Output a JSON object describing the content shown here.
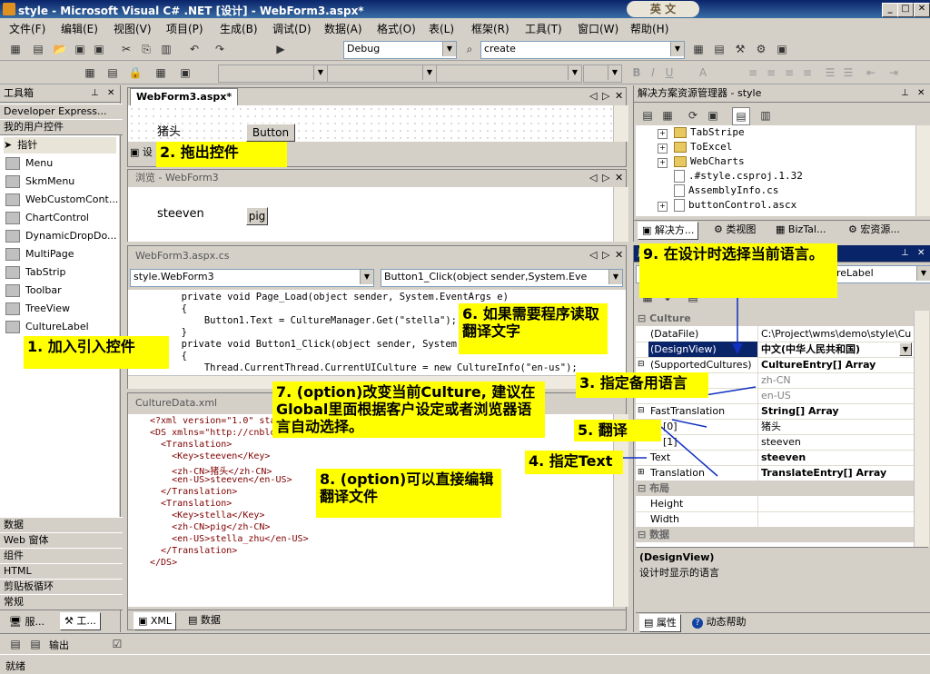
{
  "window": {
    "title": "style - Microsoft Visual C# .NET [设计] - WebForm3.aspx*",
    "logo_text": "英 文",
    "min": "_",
    "max": "□",
    "close": "✕"
  },
  "menu": [
    "文件(F)",
    "编辑(E)",
    "视图(V)",
    "项目(P)",
    "生成(B)",
    "调试(D)",
    "数据(A)",
    "格式(O)",
    "表(L)",
    "框架(R)",
    "工具(T)",
    "窗口(W)",
    "帮助(H)"
  ],
  "toolbar": {
    "config": "Debug",
    "find": "create"
  },
  "toolbox": {
    "title": "工具箱",
    "categories_top": [
      "Developer Express...",
      "我的用户控件"
    ],
    "items": [
      "指针",
      "Menu",
      "SkmMenu",
      "WebCustomCont...",
      "ChartControl",
      "DynamicDropDo...",
      "MultiPage",
      "TabStrip",
      "Toolbar",
      "TreeView",
      "CultureLabel"
    ],
    "categories_bottom": [
      "数据",
      "Web 窗体",
      "组件",
      "HTML",
      "剪贴板循环",
      "常规"
    ],
    "bottom_tabs": [
      "服...",
      "工..."
    ]
  },
  "designer": {
    "tab": "WebForm3.aspx*",
    "label_text": "猪头",
    "button_text": "Button"
  },
  "browser": {
    "title": "浏览 - WebForm3",
    "text": "steeven",
    "button_text": "pig"
  },
  "code": {
    "tab": "WebForm3.aspx.cs",
    "class_combo": "style.WebForm3",
    "method_combo": "Button1_Click(object sender,System.Eve",
    "lines": [
      "        private void Page_Load(object sender, System.EventArgs e)",
      "        {",
      "            Button1.Text = CultureManager.Get(\"stella\");",
      "        }",
      "        private void Button1_Click(object sender, System.",
      "        {",
      "            Thread.CurrentThread.CurrentUICulture = new CultureInfo(\"en-us\");"
    ]
  },
  "xml": {
    "tab": "CultureData.xml",
    "lines": [
      "<?xml version=\"1.0\" sta",
      "<DS xmlns=\"http://cnblo",
      "  <Translation>",
      "    <Key>steeven</Key>",
      "    <zh-CN>猪头</zh-CN>",
      "    <en-US>steeven</en-US>",
      "  </Translation>",
      "  <Translation>",
      "    <Key>stella</Key>",
      "    <zh-CN>pig</zh-CN>",
      "    <en-US>stella_zhu</en-US>",
      "  </Translation>",
      "</DS>"
    ],
    "bottom_tabs": [
      "XML",
      "数据"
    ]
  },
  "output": {
    "label": "输出"
  },
  "status": {
    "text": "就绪"
  },
  "solution": {
    "title": "解决方案资源管理器 - style",
    "items": [
      "TabStripe",
      "ToExcel",
      "WebCharts",
      ".#style.csproj.1.32",
      "AssemblyInfo.cs",
      "buttonControl.ascx"
    ],
    "tabs": [
      "解决方...",
      "类视图",
      "BizTal...",
      "宏资源..."
    ]
  },
  "properties": {
    "title": "属性",
    "object_combo": "reLabel",
    "rows": [
      {
        "k": "Culture",
        "cat": true
      },
      {
        "k": "(DataFile)",
        "v": "C:\\Project\\wms\\demo\\style\\Cu",
        "style": "norm"
      },
      {
        "k": "(DesignView)",
        "v": "中文(中华人民共和国)",
        "style": "bold",
        "selected": true
      },
      {
        "k": "(SupportedCultures)",
        "v": "CultureEntry[] Array",
        "style": "bold"
      },
      {
        "k": "",
        "v": "zh-CN",
        "style": "gray"
      },
      {
        "k": "",
        "v": "en-US",
        "style": "gray"
      },
      {
        "k": "FastTranslation",
        "v": "String[] Array",
        "style": "bold"
      },
      {
        "k": "[0]",
        "v": "猪头",
        "style": "norm"
      },
      {
        "k": "[1]",
        "v": "steeven",
        "style": "norm"
      },
      {
        "k": "Text",
        "v": "steeven",
        "style": "bold"
      },
      {
        "k": "Translation",
        "v": "TranslateEntry[] Array",
        "style": "bold"
      },
      {
        "k": "布局",
        "cat": true
      },
      {
        "k": "Height",
        "v": "",
        "style": "norm"
      },
      {
        "k": "Width",
        "v": "",
        "style": "norm"
      },
      {
        "k": "数据",
        "cat": true
      }
    ],
    "desc_title": "(DesignView)",
    "desc_text": "设计时显示的语言",
    "tabs": [
      "属性",
      "动态帮助"
    ]
  },
  "notes": {
    "n1": "1. 加入引入控件",
    "n2": "2. 拖出控件",
    "n3": "3. 指定备用语言",
    "n4": "4. 指定Text",
    "n5": "5. 翻译",
    "n6": "6. 如果需要程序读取翻译文字",
    "n7": "7. (option)改变当前Culture, 建议在Global里面根据客户设定或者浏览器语言自动选择。",
    "n8": "8. (option)可以直接编辑翻译文件",
    "n9": "9. 在设计时选择当前语言。"
  }
}
